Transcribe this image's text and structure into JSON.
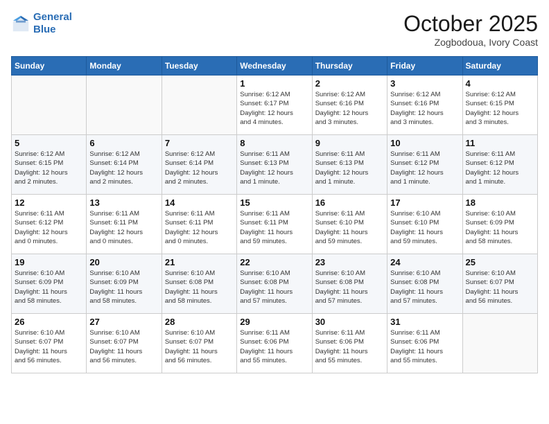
{
  "header": {
    "logo_line1": "General",
    "logo_line2": "Blue",
    "month": "October 2025",
    "location": "Zogbodoua, Ivory Coast"
  },
  "weekdays": [
    "Sunday",
    "Monday",
    "Tuesday",
    "Wednesday",
    "Thursday",
    "Friday",
    "Saturday"
  ],
  "weeks": [
    [
      {
        "day": "",
        "info": ""
      },
      {
        "day": "",
        "info": ""
      },
      {
        "day": "",
        "info": ""
      },
      {
        "day": "1",
        "info": "Sunrise: 6:12 AM\nSunset: 6:17 PM\nDaylight: 12 hours\nand 4 minutes."
      },
      {
        "day": "2",
        "info": "Sunrise: 6:12 AM\nSunset: 6:16 PM\nDaylight: 12 hours\nand 3 minutes."
      },
      {
        "day": "3",
        "info": "Sunrise: 6:12 AM\nSunset: 6:16 PM\nDaylight: 12 hours\nand 3 minutes."
      },
      {
        "day": "4",
        "info": "Sunrise: 6:12 AM\nSunset: 6:15 PM\nDaylight: 12 hours\nand 3 minutes."
      }
    ],
    [
      {
        "day": "5",
        "info": "Sunrise: 6:12 AM\nSunset: 6:15 PM\nDaylight: 12 hours\nand 2 minutes."
      },
      {
        "day": "6",
        "info": "Sunrise: 6:12 AM\nSunset: 6:14 PM\nDaylight: 12 hours\nand 2 minutes."
      },
      {
        "day": "7",
        "info": "Sunrise: 6:12 AM\nSunset: 6:14 PM\nDaylight: 12 hours\nand 2 minutes."
      },
      {
        "day": "8",
        "info": "Sunrise: 6:11 AM\nSunset: 6:13 PM\nDaylight: 12 hours\nand 1 minute."
      },
      {
        "day": "9",
        "info": "Sunrise: 6:11 AM\nSunset: 6:13 PM\nDaylight: 12 hours\nand 1 minute."
      },
      {
        "day": "10",
        "info": "Sunrise: 6:11 AM\nSunset: 6:12 PM\nDaylight: 12 hours\nand 1 minute."
      },
      {
        "day": "11",
        "info": "Sunrise: 6:11 AM\nSunset: 6:12 PM\nDaylight: 12 hours\nand 1 minute."
      }
    ],
    [
      {
        "day": "12",
        "info": "Sunrise: 6:11 AM\nSunset: 6:12 PM\nDaylight: 12 hours\nand 0 minutes."
      },
      {
        "day": "13",
        "info": "Sunrise: 6:11 AM\nSunset: 6:11 PM\nDaylight: 12 hours\nand 0 minutes."
      },
      {
        "day": "14",
        "info": "Sunrise: 6:11 AM\nSunset: 6:11 PM\nDaylight: 12 hours\nand 0 minutes."
      },
      {
        "day": "15",
        "info": "Sunrise: 6:11 AM\nSunset: 6:11 PM\nDaylight: 11 hours\nand 59 minutes."
      },
      {
        "day": "16",
        "info": "Sunrise: 6:11 AM\nSunset: 6:10 PM\nDaylight: 11 hours\nand 59 minutes."
      },
      {
        "day": "17",
        "info": "Sunrise: 6:10 AM\nSunset: 6:10 PM\nDaylight: 11 hours\nand 59 minutes."
      },
      {
        "day": "18",
        "info": "Sunrise: 6:10 AM\nSunset: 6:09 PM\nDaylight: 11 hours\nand 58 minutes."
      }
    ],
    [
      {
        "day": "19",
        "info": "Sunrise: 6:10 AM\nSunset: 6:09 PM\nDaylight: 11 hours\nand 58 minutes."
      },
      {
        "day": "20",
        "info": "Sunrise: 6:10 AM\nSunset: 6:09 PM\nDaylight: 11 hours\nand 58 minutes."
      },
      {
        "day": "21",
        "info": "Sunrise: 6:10 AM\nSunset: 6:08 PM\nDaylight: 11 hours\nand 58 minutes."
      },
      {
        "day": "22",
        "info": "Sunrise: 6:10 AM\nSunset: 6:08 PM\nDaylight: 11 hours\nand 57 minutes."
      },
      {
        "day": "23",
        "info": "Sunrise: 6:10 AM\nSunset: 6:08 PM\nDaylight: 11 hours\nand 57 minutes."
      },
      {
        "day": "24",
        "info": "Sunrise: 6:10 AM\nSunset: 6:08 PM\nDaylight: 11 hours\nand 57 minutes."
      },
      {
        "day": "25",
        "info": "Sunrise: 6:10 AM\nSunset: 6:07 PM\nDaylight: 11 hours\nand 56 minutes."
      }
    ],
    [
      {
        "day": "26",
        "info": "Sunrise: 6:10 AM\nSunset: 6:07 PM\nDaylight: 11 hours\nand 56 minutes."
      },
      {
        "day": "27",
        "info": "Sunrise: 6:10 AM\nSunset: 6:07 PM\nDaylight: 11 hours\nand 56 minutes."
      },
      {
        "day": "28",
        "info": "Sunrise: 6:10 AM\nSunset: 6:07 PM\nDaylight: 11 hours\nand 56 minutes."
      },
      {
        "day": "29",
        "info": "Sunrise: 6:11 AM\nSunset: 6:06 PM\nDaylight: 11 hours\nand 55 minutes."
      },
      {
        "day": "30",
        "info": "Sunrise: 6:11 AM\nSunset: 6:06 PM\nDaylight: 11 hours\nand 55 minutes."
      },
      {
        "day": "31",
        "info": "Sunrise: 6:11 AM\nSunset: 6:06 PM\nDaylight: 11 hours\nand 55 minutes."
      },
      {
        "day": "",
        "info": ""
      }
    ]
  ]
}
